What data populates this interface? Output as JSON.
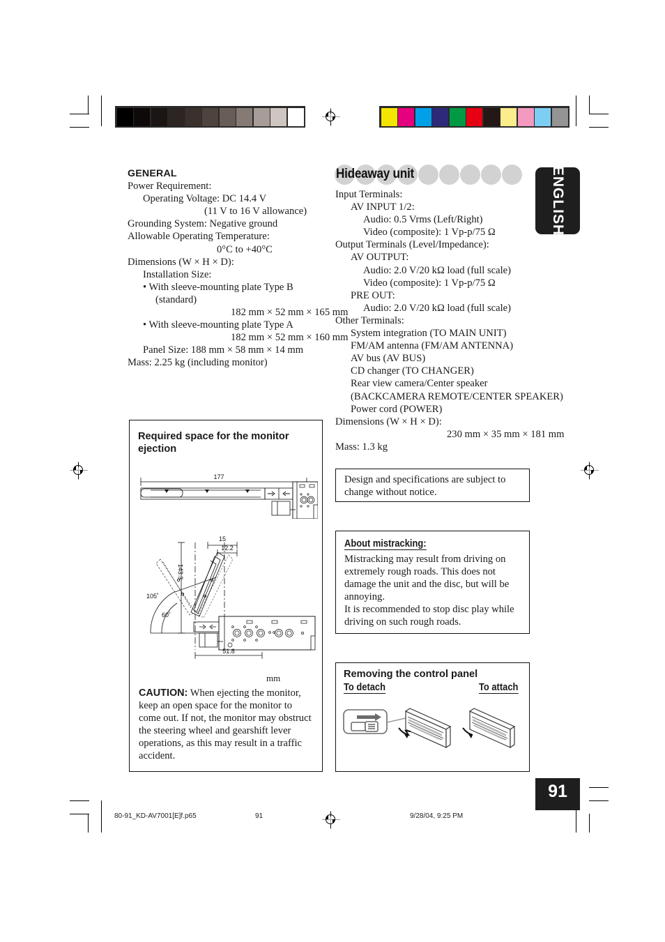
{
  "page": {
    "number": "91",
    "side_tab": "ENGLISH",
    "footer_file": "80-91_KD-AV7001[E]f.p65",
    "footer_page": "91",
    "footer_date": "9/28/04, 9:25 PM"
  },
  "printer_marks": {
    "gray_wedge": [
      "#000000",
      "#0d0a09",
      "#1b1613",
      "#2d2522",
      "#3a312d",
      "#4e433e",
      "#695d57",
      "#867a74",
      "#a79c97",
      "#cfc6c1",
      "#ffffff"
    ],
    "color_bars": [
      "#f5e400",
      "#e5007f",
      "#00a0e9",
      "#2d2a7c",
      "#009944",
      "#e60012",
      "#231815",
      "#fbec8c",
      "#f49ac1",
      "#7ecef4",
      "#949495"
    ]
  },
  "left_column": {
    "heading": "GENERAL",
    "lines": [
      {
        "text": "Power Requirement:",
        "indent": 0
      },
      {
        "text": "Operating Voltage: DC 14.4 V",
        "indent": 1
      },
      {
        "text": "(11 V to 16 V allowance)",
        "indent": 5
      },
      {
        "text": "Grounding System: Negative ground",
        "indent": 0
      },
      {
        "text": "Allowable Operating Temperature:",
        "indent": 0
      },
      {
        "text": "0°C to +40°C",
        "indent": 6
      },
      {
        "text": "Dimensions (W × H × D):",
        "indent": 0
      },
      {
        "text": "Installation Size:",
        "indent": 1
      },
      {
        "text": "• With sleeve-mounting plate Type B",
        "indent": 1
      },
      {
        "text": "(standard)",
        "indent": 2
      },
      {
        "text": "182 mm × 52 mm × 165 mm",
        "indent": 7
      },
      {
        "text": "• With sleeve-mounting plate Type A",
        "indent": 1
      },
      {
        "text": "182 mm × 52 mm × 160 mm",
        "indent": 7
      },
      {
        "text": "Panel Size: 188 mm × 58 mm × 14 mm",
        "indent": 1
      },
      {
        "text": "Mass: 2.25 kg (including monitor)",
        "indent": 0
      }
    ]
  },
  "monitor_box": {
    "heading_line1": "Required space for the monitor",
    "heading_line2": "ejection",
    "unit_label": "mm",
    "diagram_labels": {
      "top_width": "177",
      "height": "143.3",
      "dim_15": "15",
      "dim_12_2": "12.2",
      "angle_105": "105˚",
      "angle_60": "60˚",
      "dim_51_8": "51.8"
    },
    "caution_label": "CAUTION:",
    "caution_text": " When ejecting the monitor, keep an open space for the monitor to come out. If not, the monitor may obstruct the steering wheel and gearshift lever operations, as this may result in a traffic accident."
  },
  "right_column": {
    "heading": "Hideaway unit",
    "lines": [
      {
        "text": "Input Terminals:",
        "indent": 0
      },
      {
        "text": "AV INPUT 1/2:",
        "indent": 1
      },
      {
        "text": "Audio: 0.5 Vrms (Left/Right)",
        "indent": 2
      },
      {
        "text": "Video (composite): 1 Vp-p/75 Ω",
        "indent": 2
      },
      {
        "text": "Output Terminals (Level/Impedance):",
        "indent": 0
      },
      {
        "text": "AV OUTPUT:",
        "indent": 1
      },
      {
        "text": "Audio: 2.0 V/20 kΩ load (full scale)",
        "indent": 2
      },
      {
        "text": "Video (composite): 1 Vp-p/75 Ω",
        "indent": 2
      },
      {
        "text": "PRE OUT:",
        "indent": 1
      },
      {
        "text": "Audio: 2.0 V/20 kΩ load (full scale)",
        "indent": 2
      },
      {
        "text": "Other Terminals:",
        "indent": 0
      },
      {
        "text": "System integration (TO MAIN UNIT)",
        "indent": 1
      },
      {
        "text": "FM/AM antenna (FM/AM ANTENNA)",
        "indent": 1
      },
      {
        "text": "AV bus (AV BUS)",
        "indent": 1
      },
      {
        "text": "CD changer (TO CHANGER)",
        "indent": 1
      },
      {
        "text": "Rear view camera/Center speaker",
        "indent": 1
      },
      {
        "text": "(BACKCAMERA REMOTE/CENTER SPEAKER)",
        "indent": 1
      },
      {
        "text": "Power cord (POWER)",
        "indent": 1
      },
      {
        "text": "Dimensions (W × H × D):",
        "indent": 0
      },
      {
        "text": "230 mm × 35 mm × 181 mm",
        "indent": 8
      },
      {
        "text": "Mass: 1.3 kg",
        "indent": 0
      }
    ]
  },
  "design_box": {
    "line1": "Design and specifications are subject to",
    "line2": "change without notice."
  },
  "mistracking_box": {
    "heading": "About mistracking:",
    "line1": "Mistracking may result from driving on",
    "line2": "extremely rough roads. This does not",
    "line3": "damage the unit and the disc, but will be",
    "line4": "annoying.",
    "line5": "It is recommended to stop disc play while",
    "line6": "driving on such rough roads."
  },
  "control_panel_box": {
    "heading": "Removing the control panel",
    "label_detach": "To detach",
    "label_attach": "To attach"
  }
}
